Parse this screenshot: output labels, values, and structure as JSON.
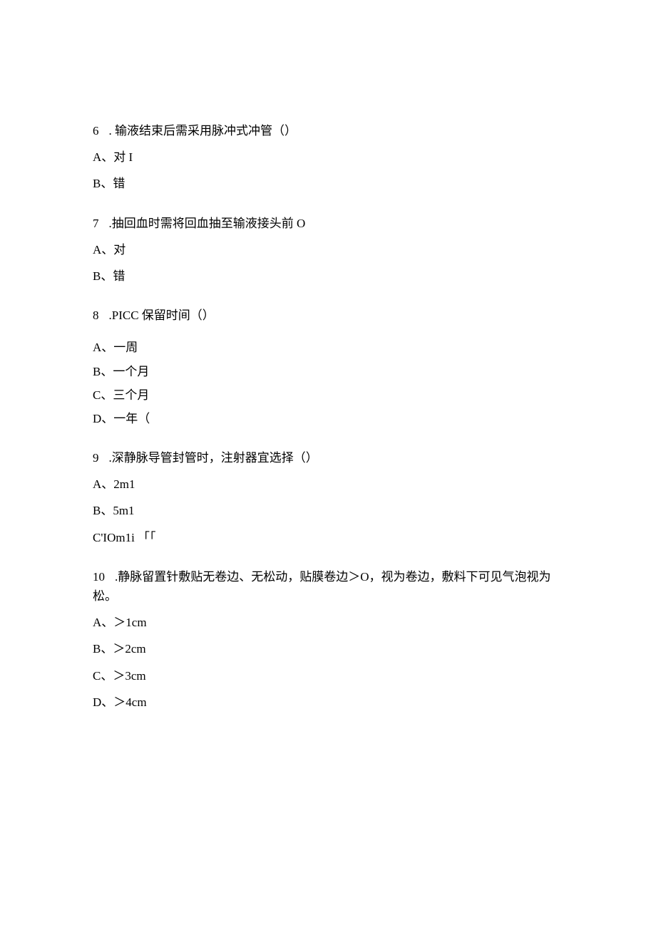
{
  "questions": [
    {
      "num": "6",
      "stem": ". 输液结束后需采用脉冲式冲管（）",
      "options": [
        "A、对 I",
        "B、错"
      ]
    },
    {
      "num": "7",
      "stem": ".抽回血时需将回血抽至输液接头前 O",
      "options": [
        "A、对",
        "B、错"
      ]
    },
    {
      "num": "8",
      "stem": ".PICC 保留时间（）",
      "options": [
        "A、一周",
        "B、一个月",
        "C、三个月",
        "D、一年（"
      ]
    },
    {
      "num": "9",
      "stem": ".深静脉导管封管时，注射器宜选择（）",
      "options": [
        "A、2m1",
        "B、5m1",
        "C'IOm1i 「「"
      ]
    },
    {
      "num": "10",
      "stem": ".静脉留置针敷贴无卷边、无松动，贴膜卷边＞O，视为卷边，敷料下可见气泡视为松。",
      "options": [
        "A、＞1cm",
        "B、＞2cm",
        "C、＞3cm",
        "D、＞4cm"
      ]
    }
  ]
}
